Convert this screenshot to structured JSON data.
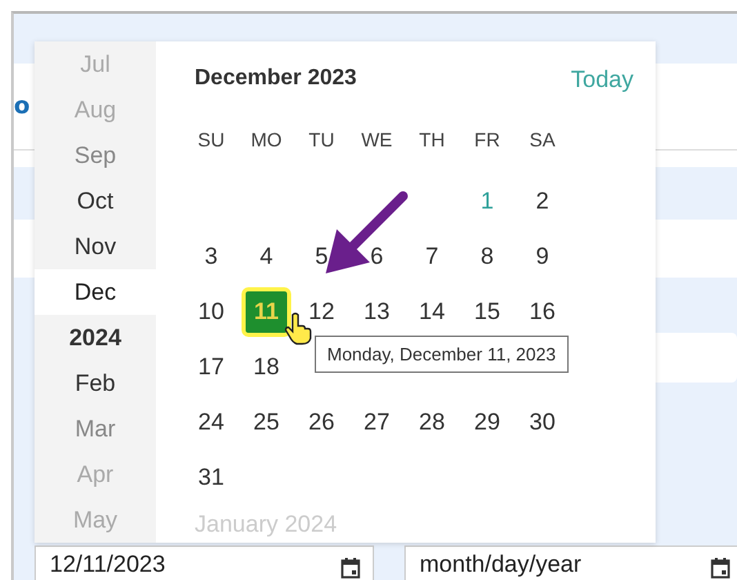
{
  "page": {
    "cut_label": "o"
  },
  "months": [
    {
      "label": "Jul",
      "kind": "month",
      "selected": false
    },
    {
      "label": "Aug",
      "kind": "month",
      "selected": false
    },
    {
      "label": "Sep",
      "kind": "month",
      "selected": false
    },
    {
      "label": "Oct",
      "kind": "month",
      "selected": false
    },
    {
      "label": "Nov",
      "kind": "month",
      "selected": false
    },
    {
      "label": "Dec",
      "kind": "month",
      "selected": true
    },
    {
      "label": "2024",
      "kind": "year",
      "selected": false
    },
    {
      "label": "Feb",
      "kind": "month",
      "selected": false
    },
    {
      "label": "Mar",
      "kind": "month",
      "selected": false
    },
    {
      "label": "Apr",
      "kind": "month",
      "selected": false
    },
    {
      "label": "May",
      "kind": "month",
      "selected": false
    }
  ],
  "calendar": {
    "title": "December 2023",
    "today_link": "Today",
    "weekdays": [
      "SU",
      "MO",
      "TU",
      "WE",
      "TH",
      "FR",
      "SA"
    ],
    "weeks": [
      [
        {
          "kind": "blank"
        },
        {
          "kind": "blank"
        },
        {
          "kind": "blank"
        },
        {
          "kind": "blank"
        },
        {
          "kind": "blank"
        },
        {
          "kind": "day",
          "day": "1",
          "today": true,
          "selected": false
        },
        {
          "kind": "day",
          "day": "2",
          "today": false,
          "selected": false
        }
      ],
      [
        {
          "kind": "day",
          "day": "3",
          "today": false,
          "selected": false
        },
        {
          "kind": "day",
          "day": "4",
          "today": false,
          "selected": false
        },
        {
          "kind": "day",
          "day": "5",
          "today": false,
          "selected": false
        },
        {
          "kind": "day",
          "day": "6",
          "today": false,
          "selected": false
        },
        {
          "kind": "day",
          "day": "7",
          "today": false,
          "selected": false
        },
        {
          "kind": "day",
          "day": "8",
          "today": false,
          "selected": false
        },
        {
          "kind": "day",
          "day": "9",
          "today": false,
          "selected": false
        }
      ],
      [
        {
          "kind": "day",
          "day": "10",
          "today": false,
          "selected": false
        },
        {
          "kind": "day",
          "day": "11",
          "today": false,
          "selected": true
        },
        {
          "kind": "day",
          "day": "12",
          "today": false,
          "selected": false
        },
        {
          "kind": "day",
          "day": "13",
          "today": false,
          "selected": false
        },
        {
          "kind": "day",
          "day": "14",
          "today": false,
          "selected": false
        },
        {
          "kind": "day",
          "day": "15",
          "today": false,
          "selected": false
        },
        {
          "kind": "day",
          "day": "16",
          "today": false,
          "selected": false
        }
      ],
      [
        {
          "kind": "day",
          "day": "17",
          "today": false,
          "selected": false
        },
        {
          "kind": "day",
          "day": "18",
          "today": false,
          "selected": false
        },
        {
          "kind": "blank"
        },
        {
          "kind": "blank"
        },
        {
          "kind": "blank"
        },
        {
          "kind": "blank"
        },
        {
          "kind": "blank"
        }
      ],
      [
        {
          "kind": "day",
          "day": "24",
          "today": false,
          "selected": false
        },
        {
          "kind": "day",
          "day": "25",
          "today": false,
          "selected": false
        },
        {
          "kind": "day",
          "day": "26",
          "today": false,
          "selected": false
        },
        {
          "kind": "day",
          "day": "27",
          "today": false,
          "selected": false
        },
        {
          "kind": "day",
          "day": "28",
          "today": false,
          "selected": false
        },
        {
          "kind": "day",
          "day": "29",
          "today": false,
          "selected": false
        },
        {
          "kind": "day",
          "day": "30",
          "today": false,
          "selected": false
        }
      ],
      [
        {
          "kind": "day",
          "day": "31",
          "today": false,
          "selected": false
        }
      ]
    ],
    "next_month": "January 2024",
    "tooltip": "Monday, December 11, 2023"
  },
  "inputs": [
    {
      "value": "12/11/2023"
    },
    {
      "placeholder": "month/day/year"
    }
  ]
}
